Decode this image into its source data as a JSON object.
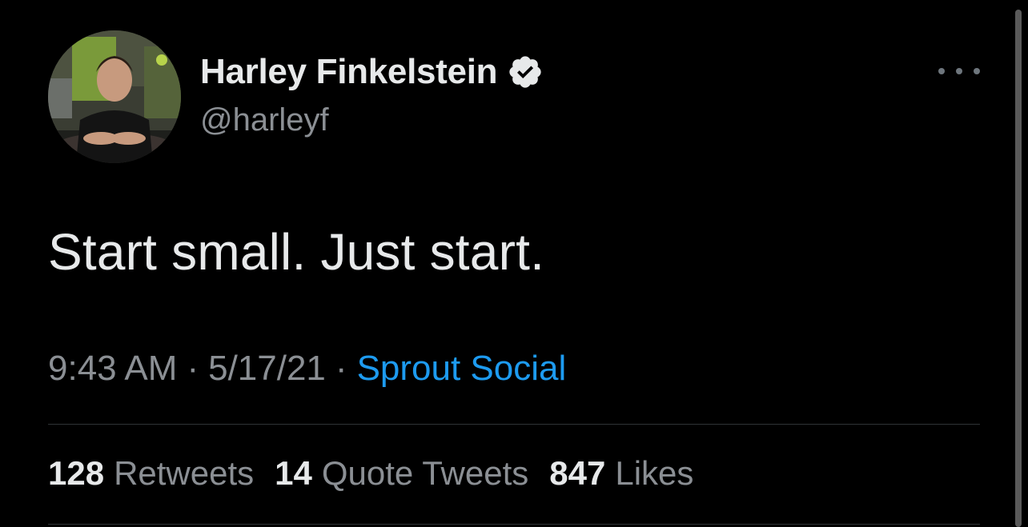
{
  "author": {
    "display_name": "Harley Finkelstein",
    "handle": "@harleyf",
    "verified": true
  },
  "tweet": {
    "text": "Start small. Just start.",
    "time": "9:43 AM",
    "date": "5/17/21",
    "separator": "·",
    "source": "Sprout Social"
  },
  "stats": {
    "retweets_count": "128",
    "retweets_label": "Retweets",
    "quotes_count": "14",
    "quotes_label": "Quote Tweets",
    "likes_count": "847",
    "likes_label": "Likes"
  },
  "icons": {
    "more": "more-horizontal-icon",
    "verified": "verified-badge-icon"
  },
  "colors": {
    "background": "#000000",
    "primary_text": "#e7e9ea",
    "secondary_text": "#8b8f94",
    "link": "#1d9bf0",
    "divider": "#2f3336"
  }
}
